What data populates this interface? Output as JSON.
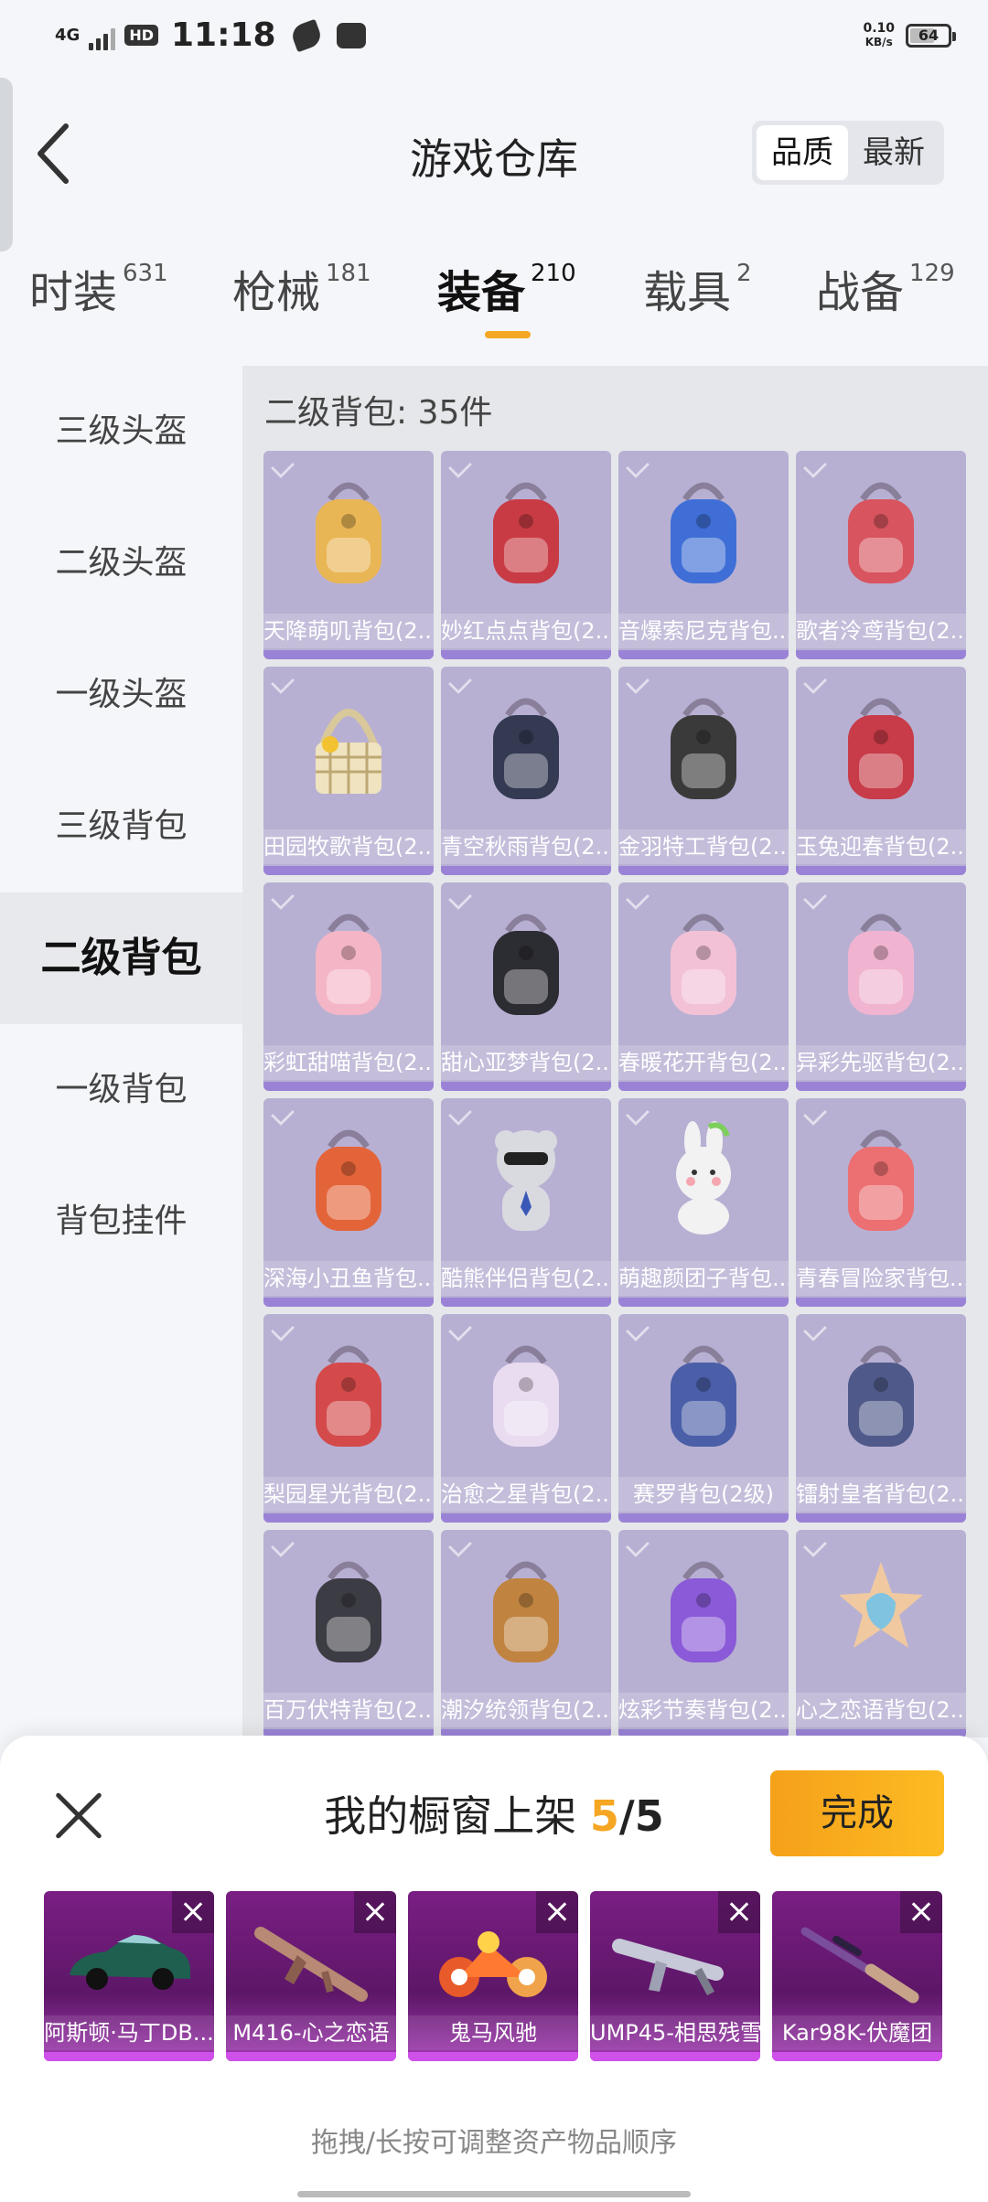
{
  "status_bar": {
    "network": "4G",
    "hd": "HD",
    "time": "11:18",
    "speed_value": "0.10",
    "speed_unit": "KB/s",
    "battery": "64"
  },
  "header": {
    "title": "游戏仓库",
    "sort_options": [
      "品质",
      "最新"
    ],
    "sort_active": 0
  },
  "tabs": [
    {
      "label": "时装",
      "count": "631"
    },
    {
      "label": "枪械",
      "count": "181"
    },
    {
      "label": "装备",
      "count": "210"
    },
    {
      "label": "载具",
      "count": "2"
    },
    {
      "label": "战备",
      "count": "129"
    }
  ],
  "active_tab": 2,
  "sidebar": {
    "items": [
      "三级头盔",
      "二级头盔",
      "一级头盔",
      "三级背包",
      "二级背包",
      "一级背包",
      "背包挂件"
    ],
    "active": 4
  },
  "content": {
    "title": "二级背包: 35件",
    "items": [
      {
        "label": "天降萌叽背包(2...",
        "icon": "backpack-icon",
        "color": "#e9b655"
      },
      {
        "label": "妙红点点背包(2...",
        "icon": "backpack-icon",
        "color": "#c93b44"
      },
      {
        "label": "音爆索尼克背包...",
        "icon": "backpack-icon",
        "color": "#3f6fd6"
      },
      {
        "label": "歌者泠鸢背包(2...",
        "icon": "backpack-icon",
        "color": "#d8545e"
      },
      {
        "label": "田园牧歌背包(2...",
        "icon": "basket-icon",
        "color": "#efe3c0"
      },
      {
        "label": "青空秋雨背包(2...",
        "icon": "backpack-icon",
        "color": "#333a52"
      },
      {
        "label": "金羽特工背包(2...",
        "icon": "backpack-icon",
        "color": "#3a3a3a"
      },
      {
        "label": "玉兔迎春背包(2...",
        "icon": "backpack-icon",
        "color": "#c83b48"
      },
      {
        "label": "彩虹甜喵背包(2...",
        "icon": "backpack-icon",
        "color": "#f4b6c6"
      },
      {
        "label": "甜心亚梦背包(2...",
        "icon": "backpack-icon",
        "color": "#2c2c33"
      },
      {
        "label": "春暖花开背包(2...",
        "icon": "backpack-icon",
        "color": "#f2c1d6"
      },
      {
        "label": "异彩先驱背包(2...",
        "icon": "backpack-icon",
        "color": "#f0b3d0"
      },
      {
        "label": "深海小丑鱼背包...",
        "icon": "backpack-icon",
        "color": "#e4643a"
      },
      {
        "label": "酷熊伴侣背包(2...",
        "icon": "bear-icon",
        "color": "#d9d9e0"
      },
      {
        "label": "萌趣颜团子背包...",
        "icon": "bunny-icon",
        "color": "#f2f2f2"
      },
      {
        "label": "青春冒险家背包...",
        "icon": "backpack-icon",
        "color": "#ec6f72"
      },
      {
        "label": "梨园星光背包(2...",
        "icon": "backpack-icon",
        "color": "#d44a4a"
      },
      {
        "label": "治愈之星背包(2...",
        "icon": "backpack-icon",
        "color": "#eadcf0"
      },
      {
        "label": "赛罗背包(2级)",
        "icon": "backpack-icon",
        "color": "#4a5fa8"
      },
      {
        "label": "镭射皇者背包(2...",
        "icon": "backpack-icon",
        "color": "#4f5a8a"
      },
      {
        "label": "百万伏特背包(2...",
        "icon": "backpack-icon",
        "color": "#3c3c44"
      },
      {
        "label": "潮汐统领背包(2...",
        "icon": "backpack-icon",
        "color": "#c08440"
      },
      {
        "label": "炫彩节奏背包(2...",
        "icon": "backpack-icon",
        "color": "#8a5ad8"
      },
      {
        "label": "心之恋语背包(2...",
        "icon": "star-backpack-icon",
        "color": "#f0c9a0"
      }
    ]
  },
  "sheet": {
    "title_prefix": "我的橱窗上架 ",
    "count_current": "5",
    "count_sep": "/",
    "count_total": "5",
    "done_label": "完成",
    "hint": "拖拽/长按可调整资产物品顺序",
    "slots": [
      {
        "label": "阿斯顿·马丁DB...",
        "icon": "car-icon"
      },
      {
        "label": "M416-心之恋语",
        "icon": "rifle-icon"
      },
      {
        "label": "鬼马风驰",
        "icon": "motorbike-icon"
      },
      {
        "label": "UMP45-相思残雪",
        "icon": "smg-icon"
      },
      {
        "label": "Kar98K-伏魔团",
        "icon": "sniper-rifle-icon"
      }
    ]
  }
}
